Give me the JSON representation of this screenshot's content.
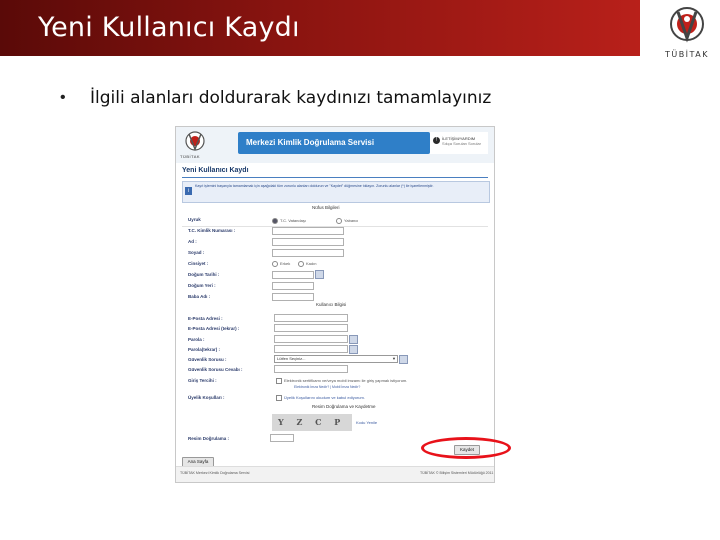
{
  "slide": {
    "title": "Yeni Kullanıcı Kaydı",
    "bullet": "İlgili alanları doldurarak kaydınızı tamamlayınız",
    "logo_text": "TÜBİTAK",
    "header_color": "#8a1410",
    "highlight_color": "#e8121a"
  },
  "screenshot": {
    "logo_text": "TÜBİTAK",
    "banner_title": "Merkezi Kimlik Doğrulama Servisi",
    "banner_side": [
      "İLETİŞİM/YARDIM",
      "Sıkça Sorulan Sorular"
    ],
    "page_title": "Yeni Kullanıcı Kaydı",
    "info_text": "Kayıt işlemini başarıyla tamamlamak için aşağıdaki tüm zorunlu alanları doldurun ve \"Kaydet\" düğmesine tıklayın. Zorunlu alanlar (*) ile işaretlenmiştir.",
    "sections": {
      "identity": "Nüfus Bilgileri",
      "user": "Kullanıcı Bilgisi",
      "captcha": "Resim Doğrulama ve Kaydetme"
    },
    "identity_fields": {
      "nationality": "Uyruk",
      "tc_option": "T.C. Vatandaşı",
      "foreign_option": "Yabancı",
      "tc_no": "T.C. Kimlik Numarası :",
      "name": "Ad :",
      "surname": "Soyad :",
      "gender": "Cinsiyet :",
      "male": "Erkek",
      "female": "Kadın",
      "birth_date": "Doğum Tarihi :",
      "birth_place": "Doğum Yeri :",
      "father_name": "Baba Adı :"
    },
    "user_fields": {
      "email": "E-Posta Adresi :",
      "email_again": "E-Posta Adresi (tekrar) :",
      "password": "Parola :",
      "password_again": "Parola(tekrar) :",
      "security_question": "Güvenlik Sorusu :",
      "security_question_value": "Lütfen Seçiniz...",
      "security_answer": "Güvenlik Sorusu Cevabı :",
      "login_preference": "Giriş Tercihi :",
      "login_preference_text": "Elektronik sertifikamı ve/veya mobil imzamı ile giriş yapmak istiyorum.",
      "login_preference_links": "Elektronik İmza Nedir? | Mobil İmza Nedir?",
      "terms": "Üyelik Koşulları :",
      "terms_text": "Üyelik Koşullarını okudum ve kabul ediyorum."
    },
    "captcha": {
      "code": "Y Z C P",
      "refresh": "Kodu Yenile",
      "label": "Resim Doğrulama :",
      "save_button": "Kaydet"
    },
    "home_button": "Ana Sayfa",
    "footer_left": "TÜBİTAK Merkezi Kimlik Doğrulama Servisi",
    "footer_right": "TÜBİTAK © Bilişim Sistemleri Müdürlüğü 2011"
  }
}
